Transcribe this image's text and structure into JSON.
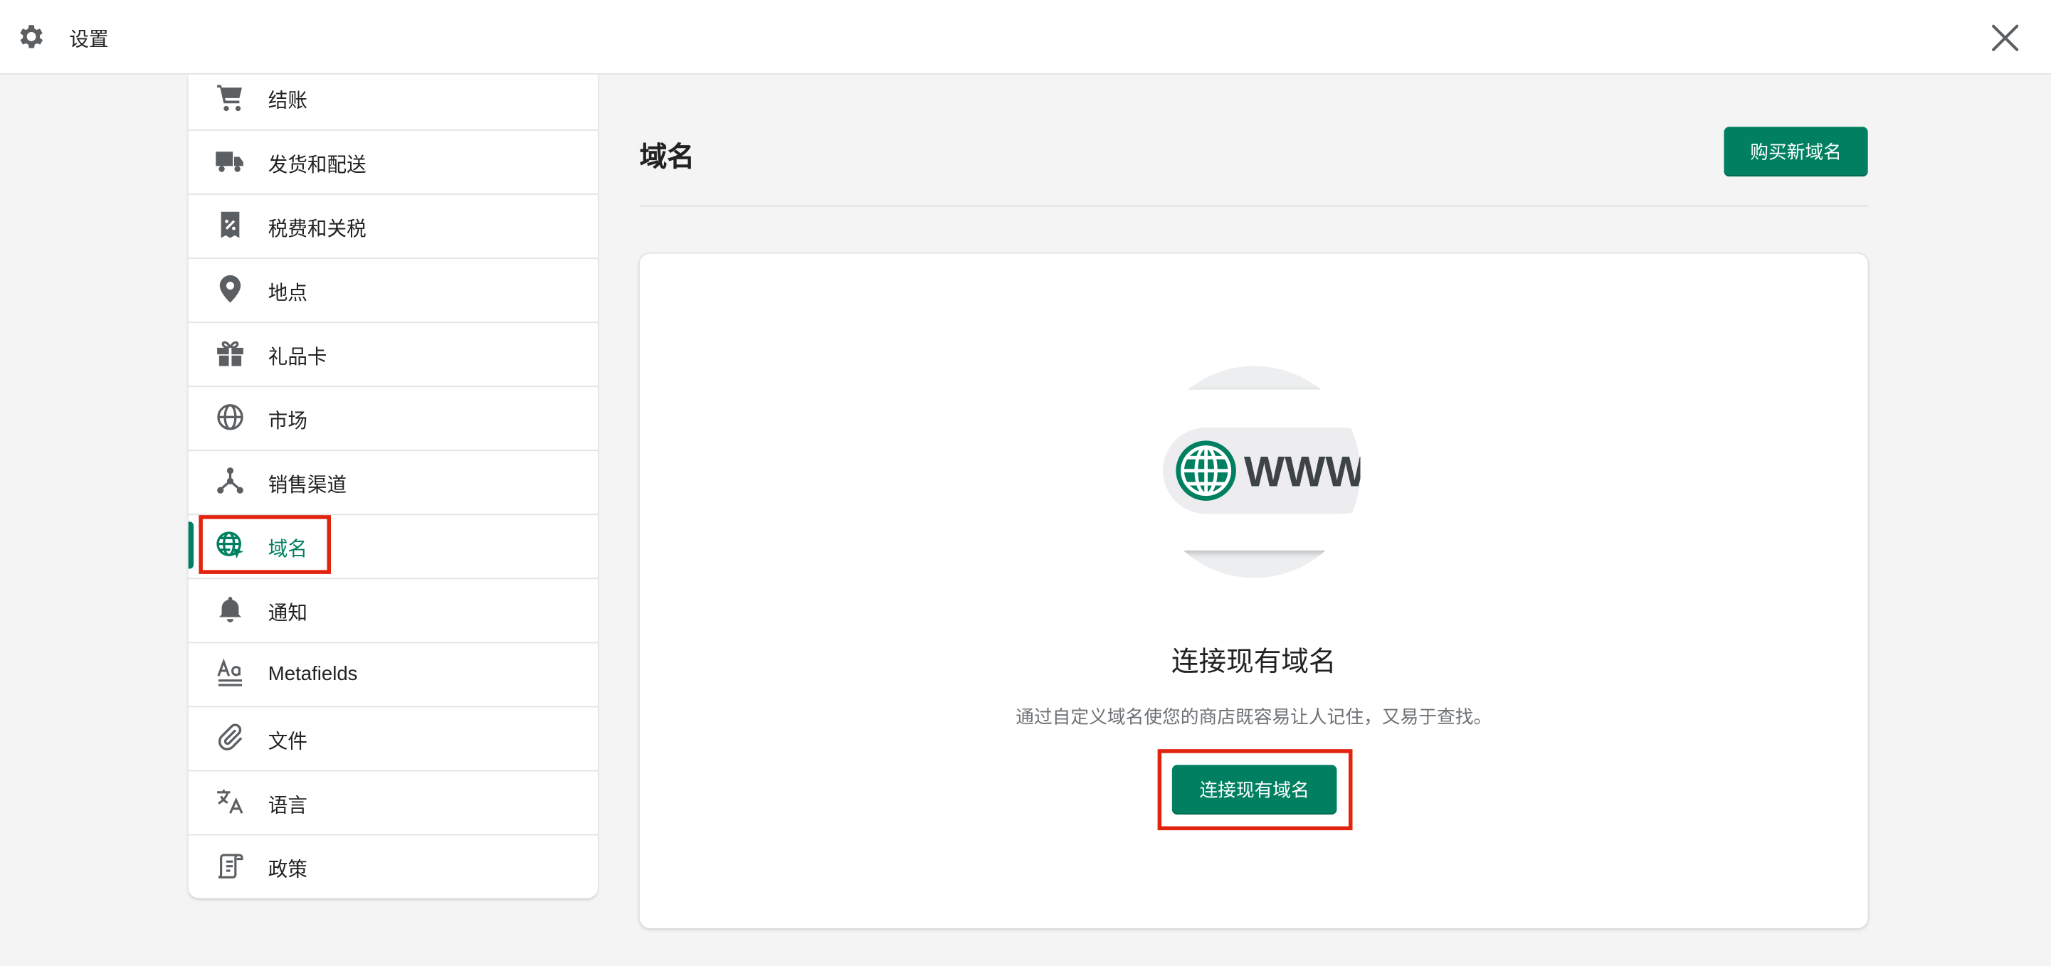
{
  "header": {
    "title": "设置"
  },
  "sidebar": {
    "items": [
      {
        "label": "结账",
        "icon": "cart-icon"
      },
      {
        "label": "发货和配送",
        "icon": "truck-icon"
      },
      {
        "label": "税费和关税",
        "icon": "tax-receipt-icon"
      },
      {
        "label": "地点",
        "icon": "location-pin-icon"
      },
      {
        "label": "礼品卡",
        "icon": "gift-icon"
      },
      {
        "label": "市场",
        "icon": "globe-grid-icon"
      },
      {
        "label": "销售渠道",
        "icon": "sales-channels-icon"
      },
      {
        "label": "域名",
        "icon": "domain-globe-icon",
        "active": true
      },
      {
        "label": "通知",
        "icon": "bell-icon"
      },
      {
        "label": "Metafields",
        "icon": "metafields-icon"
      },
      {
        "label": "文件",
        "icon": "paperclip-icon"
      },
      {
        "label": "语言",
        "icon": "translate-icon"
      },
      {
        "label": "政策",
        "icon": "policy-scroll-icon"
      }
    ]
  },
  "main": {
    "title": "域名",
    "buy_button": "购买新域名",
    "empty_state": {
      "illustration_text": "WWW",
      "title": "连接现有域名",
      "description": "通过自定义域名使您的商店既容易让人记住，又易于查找。",
      "button": "连接现有域名"
    }
  },
  "colors": {
    "accent": "#008060",
    "highlight": "#e2230e",
    "icon": "#5c5f62"
  }
}
